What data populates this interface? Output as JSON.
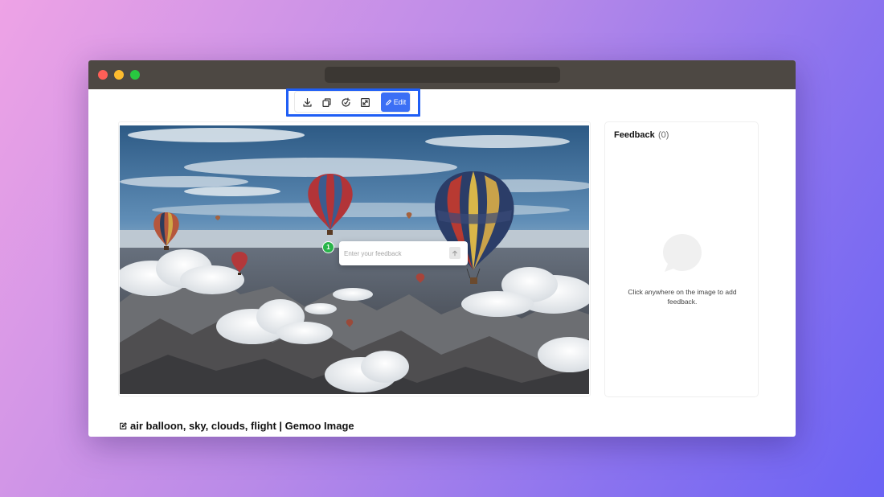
{
  "window": {
    "traffic_lights": [
      "close",
      "minimize",
      "maximize"
    ],
    "colors": {
      "red": "#fe5f57",
      "yellow": "#febc2e",
      "green": "#28c840",
      "titlebar": "#4d4843"
    }
  },
  "toolbar": {
    "buttons": [
      {
        "icon": "download-icon"
      },
      {
        "icon": "copy-icon"
      },
      {
        "icon": "refresh-icon"
      },
      {
        "icon": "expand-icon"
      }
    ],
    "edit_label": "Edit",
    "accent": "#3b6ff5",
    "highlight_color": "#1f5ef5"
  },
  "image": {
    "pin_number": "1",
    "feedback_placeholder": "Enter your feedback",
    "send_icon": "arrow-up-icon"
  },
  "feedback_panel": {
    "title": "Feedback",
    "count": "(0)",
    "empty_message": "Click anywhere on the image to add feedback.",
    "empty_icon": "chat-bubble-icon"
  },
  "page": {
    "title_icon": "edit-icon",
    "title": "air balloon, sky, clouds, flight | Gemoo Image"
  }
}
